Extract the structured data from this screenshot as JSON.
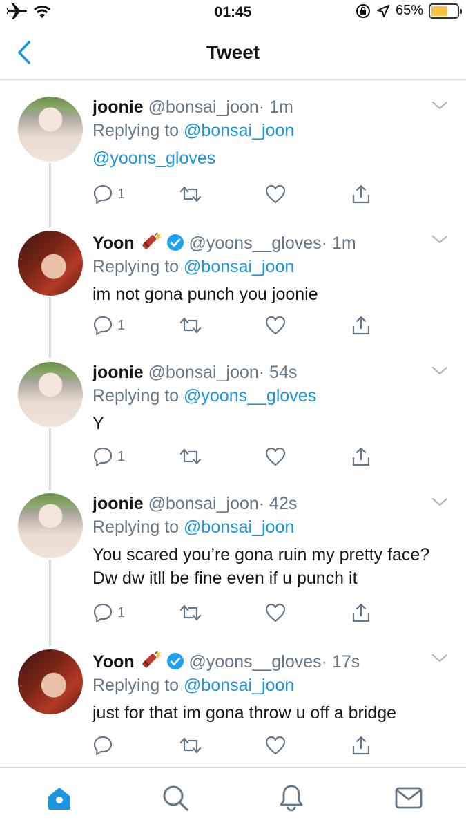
{
  "status_bar": {
    "time": "01:45",
    "battery": "65%",
    "battery_level": 0.65,
    "icons": [
      "airplane-icon",
      "wifi-icon",
      "rotation-lock-icon",
      "location-icon"
    ]
  },
  "nav": {
    "title": "Tweet",
    "back_icon": "chevron-left-icon"
  },
  "colors": {
    "link": "#1b95e0",
    "secondary": "#657786",
    "battery": "#f6c343",
    "verified": "#1da1f2"
  },
  "tweets": [
    {
      "name": "joonie",
      "handle": "@bonsai_joon",
      "time": "· 1m",
      "replying_label": "Replying to",
      "replying_to": "@bonsai_joon",
      "text": "",
      "text_link": "@yoons_gloves",
      "reply_count": "1"
    },
    {
      "name": "Yoon",
      "emoji": "firecracker",
      "verified": true,
      "handle": "@yoons__gloves",
      "time": "· 1m",
      "replying_label": "Replying to",
      "replying_to": "@bonsai_joon",
      "text": "im not gona punch you joonie",
      "reply_count": "1"
    },
    {
      "name": "joonie",
      "handle": "@bonsai_joon",
      "time": "· 54s",
      "replying_label": "Replying to",
      "replying_to": "@yoons__gloves",
      "text": "Y",
      "reply_count": "1"
    },
    {
      "name": "joonie",
      "handle": "@bonsai_joon",
      "time": "· 42s",
      "replying_label": "Replying to",
      "replying_to": "@bonsai_joon",
      "text": "You scared you’re gona ruin my pretty face? Dw dw itll be fine even if u punch it",
      "reply_count": "1"
    },
    {
      "name": "Yoon",
      "emoji": "firecracker",
      "verified": true,
      "handle": "@yoons__gloves",
      "time": "· 17s",
      "replying_label": "Replying to",
      "replying_to": "@bonsai_joon",
      "text": "just for that im gona throw u off a bridge",
      "reply_count": ""
    }
  ],
  "tabbar": {
    "items": [
      "home-icon",
      "search-icon",
      "notifications-icon",
      "messages-icon"
    ],
    "active": "home-icon"
  }
}
